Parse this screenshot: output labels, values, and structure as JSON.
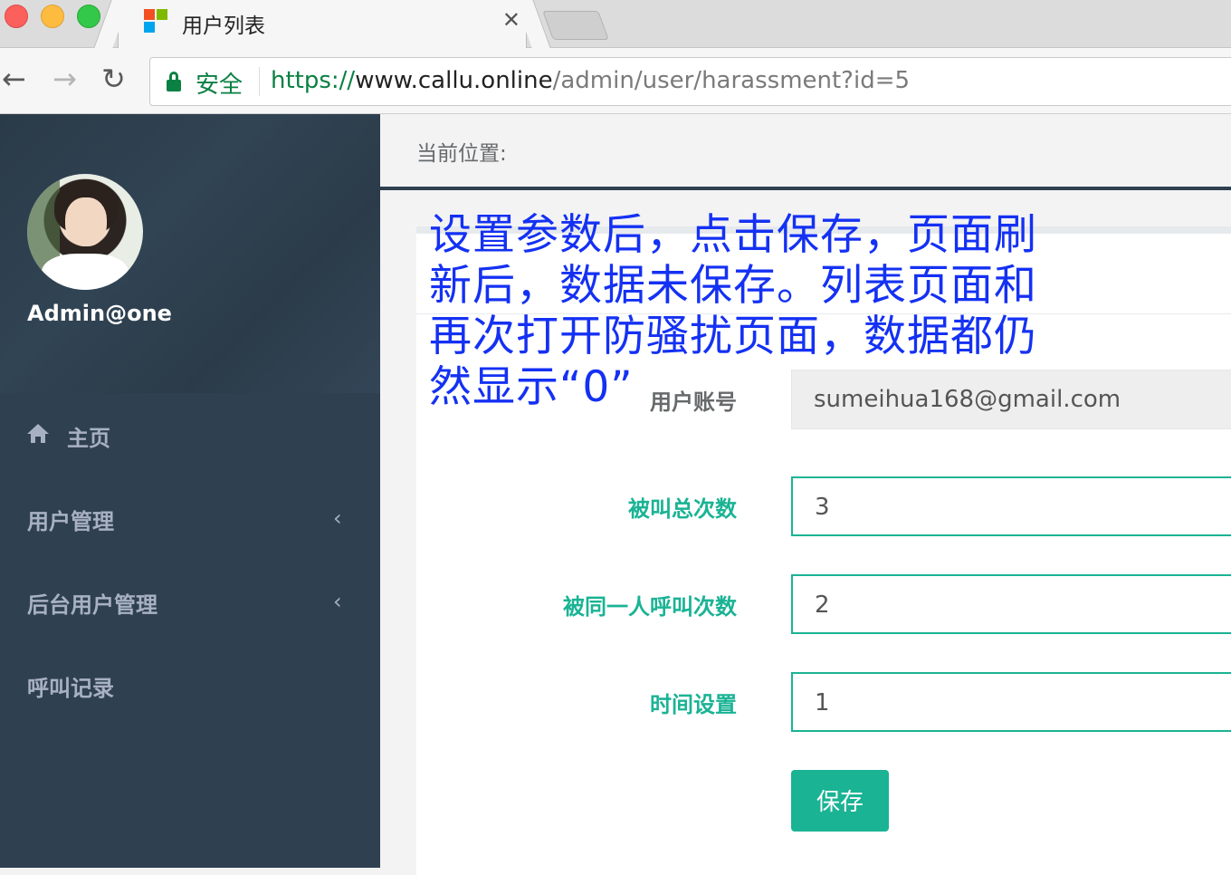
{
  "browser": {
    "tab_title": "用户列表",
    "tab_close": "✕",
    "secure_label": "安全",
    "url_scheme": "https://",
    "url_host": "www.callu.online",
    "url_path": "/admin/user/harassment?id=5",
    "icons": [
      "close-icon",
      "back-icon",
      "forward-icon",
      "reload-icon",
      "lock-icon"
    ]
  },
  "sidebar": {
    "username": "Admin@one",
    "items": [
      {
        "label": "主页",
        "icon": "home-icon"
      },
      {
        "label": "用户管理",
        "icon": "chevron-left-icon"
      },
      {
        "label": "后台用户管理",
        "icon": "chevron-left-icon"
      },
      {
        "label": "呼叫记录"
      }
    ]
  },
  "main": {
    "breadcrumb": "当前位置:",
    "annotation": "设置参数后，点击保存，页面刷新后，数据未保存。列表页面和再次打开防骚扰页面，数据都仍然显示“0”",
    "form": {
      "account_label": "用户账号",
      "account_value": "sumeihua168@gmail.com",
      "total_calls_label": "被叫总次数",
      "total_calls_value": "3",
      "same_caller_label": "被同一人呼叫次数",
      "same_caller_value": "2",
      "time_setting_label": "时间设置",
      "time_setting_value": "1",
      "save_label": "保存"
    }
  },
  "colors": {
    "sidebar_bg": "#2f4050",
    "accent": "#1ab394",
    "annotation": "#1431f3",
    "secure": "#0b8043"
  }
}
